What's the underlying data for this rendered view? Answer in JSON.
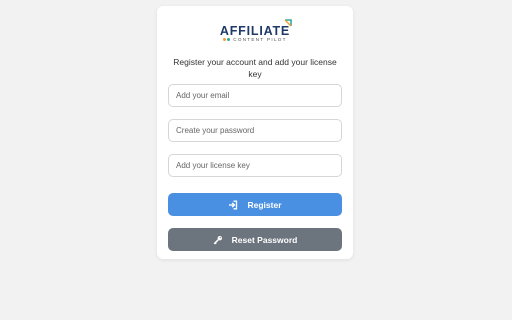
{
  "logo": {
    "wordmark": "AFFILIATE",
    "tagline": "CONTENT PILOT"
  },
  "subtitle": "Register your account and add your license key",
  "form": {
    "email_placeholder": "Add your email",
    "password_placeholder": "Create your password",
    "license_placeholder": "Add your license key"
  },
  "buttons": {
    "register_label": "Register",
    "reset_label": "Reset Password"
  },
  "colors": {
    "background": "#f2f2f2",
    "card": "#ffffff",
    "brand_navy": "#1f3a68",
    "brand_orange": "#f0a030",
    "brand_teal": "#2fa8a0",
    "register_button": "#4a90e2",
    "reset_button": "#6c757d"
  },
  "icons": {
    "register": "sign-in-icon",
    "reset": "key-icon"
  }
}
